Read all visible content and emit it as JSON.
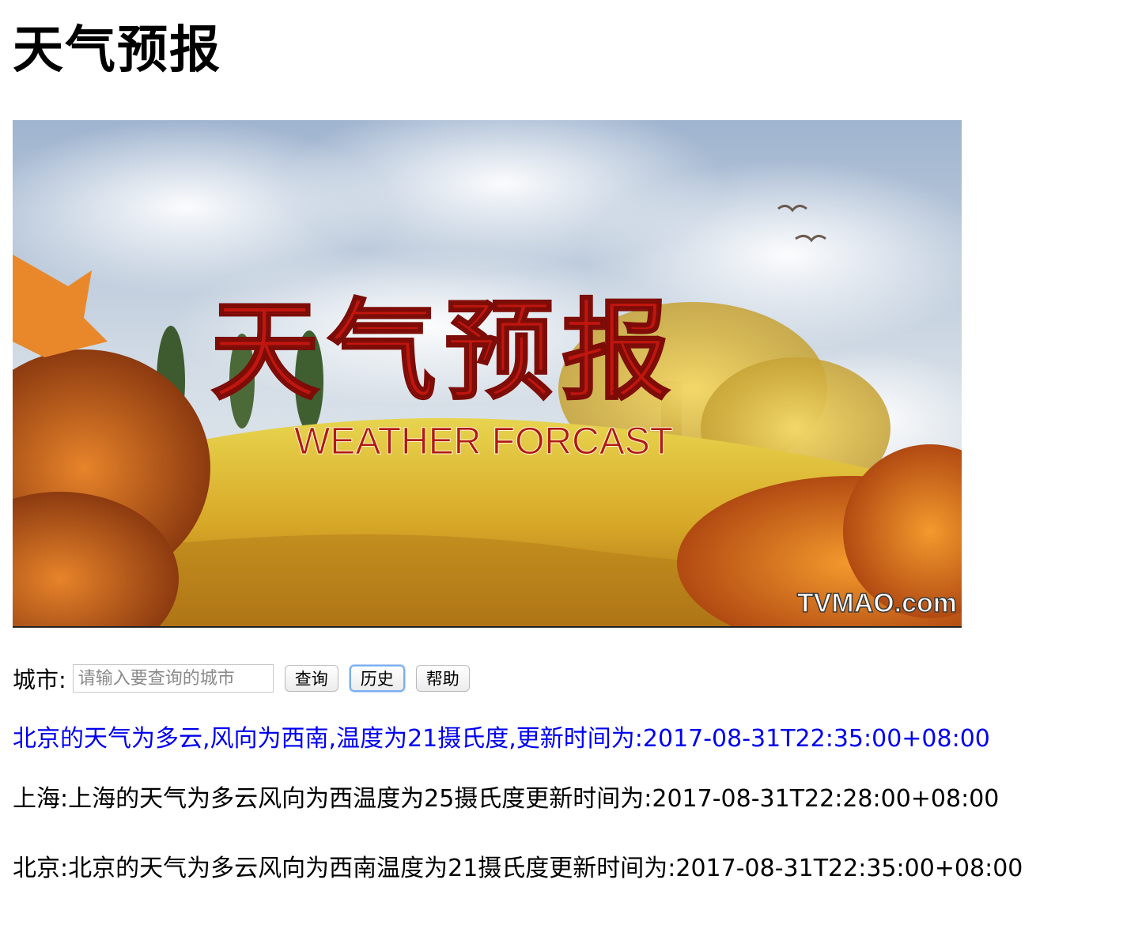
{
  "page": {
    "title": "天气预报"
  },
  "banner": {
    "title_cn": "天气预报",
    "subtitle_en": "WEATHER FORCAST",
    "watermark": "TVMAO.com",
    "colors": {
      "title": "#c0160f",
      "sky": "#a9bcd3",
      "grass": "#d9b22a",
      "foliage": "#e07b1c"
    }
  },
  "search": {
    "label": "城市:",
    "input_value": "",
    "placeholder": "请输入要查询的城市",
    "buttons": {
      "query": "查询",
      "history": "历史",
      "help": "帮助"
    }
  },
  "result": {
    "text": "北京的天气为多云,风向为西南,温度为21摄氏度,更新时间为:2017-08-31T22:35:00+08:00",
    "color": "#0000ee"
  },
  "history": [
    {
      "text": "上海:上海的天气为多云风向为西温度为25摄氏度更新时间为:2017-08-31T22:28:00+08:00"
    },
    {
      "text": "北京:北京的天气为多云风向为西南温度为21摄氏度更新时间为:2017-08-31T22:35:00+08:00"
    }
  ]
}
